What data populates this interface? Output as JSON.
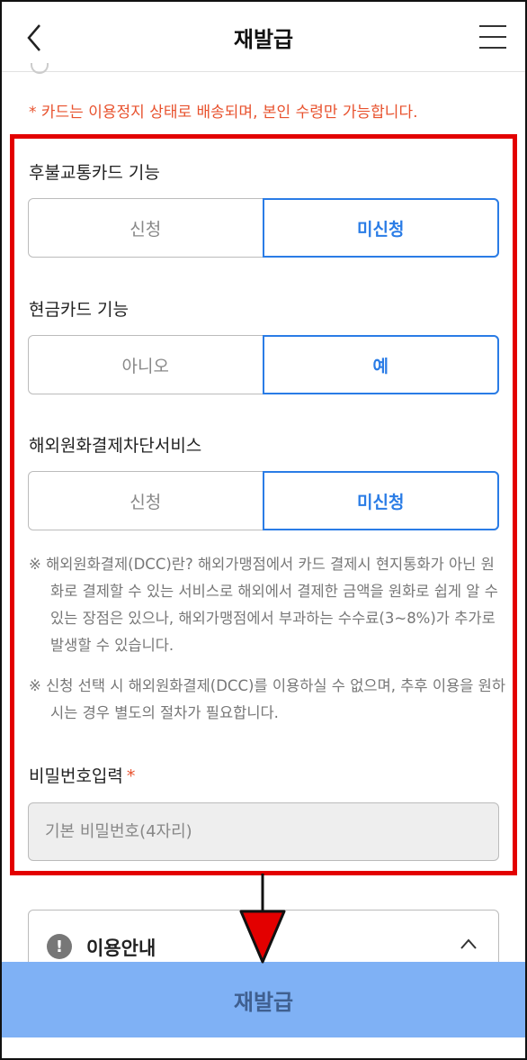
{
  "header": {
    "title": "재발급"
  },
  "notice": "* 카드는 이용정지 상태로 배송되며, 본인 수령만 가능합니다.",
  "transit": {
    "label": "후불교통카드 기능",
    "options": [
      "신청",
      "미신청"
    ],
    "selected": "미신청"
  },
  "cash": {
    "label": "현금카드 기능",
    "options": [
      "아니오",
      "예"
    ],
    "selected": "예"
  },
  "dcc": {
    "label": "해외원화결제차단서비스",
    "options": [
      "신청",
      "미신청"
    ],
    "selected": "미신청"
  },
  "notes": [
    "※ 해외원화결제(DCC)란? 해외가맹점에서 카드 결제시 현지통화가 아닌 원화로 결제할 수 있는 서비스로 해외에서 결제한 금액을 원화로 쉽게 알 수 있는 장점은 있으나, 해외가맹점에서 부과하는 수수료(3~8%)가 추가로 발생할 수 있습니다.",
    "※ 신청 선택 시 해외원화결제(DCC)를 이용하실 수 없으며, 추후 이용을 원하시는 경우 별도의 절차가 필요합니다."
  ],
  "password": {
    "label": "비밀번호입력",
    "required_mark": "*",
    "placeholder": "기본 비밀번호(4자리)"
  },
  "guide": {
    "title": "이용안내",
    "icon": "exclamation-icon"
  },
  "submit_label": "재발급",
  "colors": {
    "accent": "#2a7ce6",
    "notice": "#e8522e",
    "highlight": "#e30000",
    "button": "#7fb1f5"
  }
}
